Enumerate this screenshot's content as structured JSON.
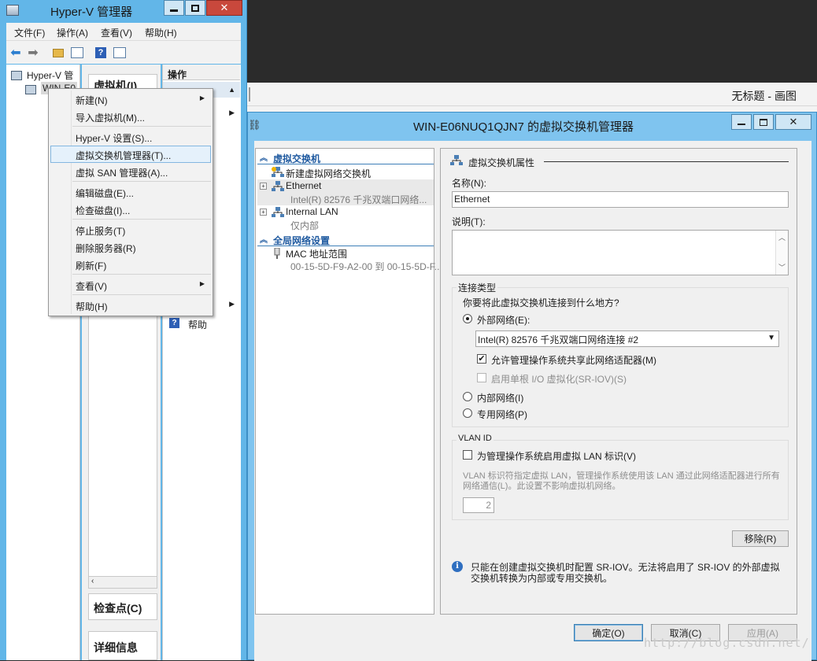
{
  "hyperv": {
    "title": "Hyper-V 管理器",
    "menu": [
      "文件(F)",
      "操作(A)",
      "查看(V)",
      "帮助(H)"
    ],
    "tree": {
      "root": "Hyper-V 管",
      "server": "WIN-E0"
    },
    "center": {
      "vm_header": "虚拟机(I)",
      "checkpoint_header": "检查点(C)",
      "details_header": "详细信息"
    },
    "actions": {
      "header": "操作",
      "help": "帮助"
    }
  },
  "context_menu": {
    "items": [
      {
        "label": "新建(N)",
        "submenu": true
      },
      {
        "label": "导入虚拟机(M)...",
        "submenu": false
      },
      {
        "label": "Hyper-V 设置(S)...",
        "submenu": false
      },
      {
        "label": "虚拟交换机管理器(T)...",
        "submenu": false,
        "highlighted": true
      },
      {
        "label": "虚拟 SAN 管理器(A)...",
        "submenu": false
      },
      {
        "label": "编辑磁盘(E)...",
        "submenu": false
      },
      {
        "label": "检查磁盘(I)...",
        "submenu": false
      },
      {
        "label": "停止服务(T)",
        "submenu": false
      },
      {
        "label": "删除服务器(R)",
        "submenu": false
      },
      {
        "label": "刷新(F)",
        "submenu": false
      },
      {
        "label": "查看(V)",
        "submenu": true
      },
      {
        "label": "帮助(H)",
        "submenu": false
      }
    ]
  },
  "paint": {
    "title": "无标题 - 画图"
  },
  "dialog": {
    "title": "WIN-E06NUQ1QJN7 的虚拟交换机管理器",
    "left": {
      "section_vswitch": "虚拟交换机",
      "new_switch": "新建虚拟网络交换机",
      "switches": [
        {
          "name": "Ethernet",
          "detail": "Intel(R) 82576 千兆双端口网络..."
        },
        {
          "name": "Internal LAN",
          "detail": "仅内部"
        }
      ],
      "section_global": "全局网络设置",
      "mac_range_label": "MAC 地址范围",
      "mac_range_value": "00-15-5D-F9-A2-00 到 00-15-5D-F..."
    },
    "props": {
      "header": "虚拟交换机属性",
      "name_label": "名称(N):",
      "name_value": "Ethernet",
      "notes_label": "说明(T):",
      "conn_type_label": "连接类型",
      "conn_question": "你要将此虚拟交换机连接到什么地方?",
      "external_label": "外部网络(E):",
      "adapter_selected": "Intel(R) 82576 千兆双端口网络连接 #2",
      "allow_mgmt_label": "允许管理操作系统共享此网络适配器(M)",
      "sriov_label": "启用单根 I/O 虚拟化(SR-IOV)(S)",
      "internal_label": "内部网络(I)",
      "private_label": "专用网络(P)",
      "vlan_group": "VLAN ID",
      "vlan_check_label": "为管理操作系统启用虚拟 LAN 标识(V)",
      "vlan_desc": "VLAN 标识符指定虚拟 LAN，管理操作系统使用该 LAN 通过此网络适配器进行所有网络通信(L)。此设置不影响虚拟机网络。",
      "vlan_value": "2",
      "remove_button": "移除(R)",
      "info_text": "只能在创建虚拟交换机时配置 SR-IOV。无法将启用了 SR-IOV 的外部虚拟交换机转换为内部或专用交换机。"
    },
    "buttons": {
      "ok": "确定(O)",
      "cancel": "取消(C)",
      "apply": "应用(A)"
    }
  },
  "watermark": "http://blog.csdn.net/"
}
